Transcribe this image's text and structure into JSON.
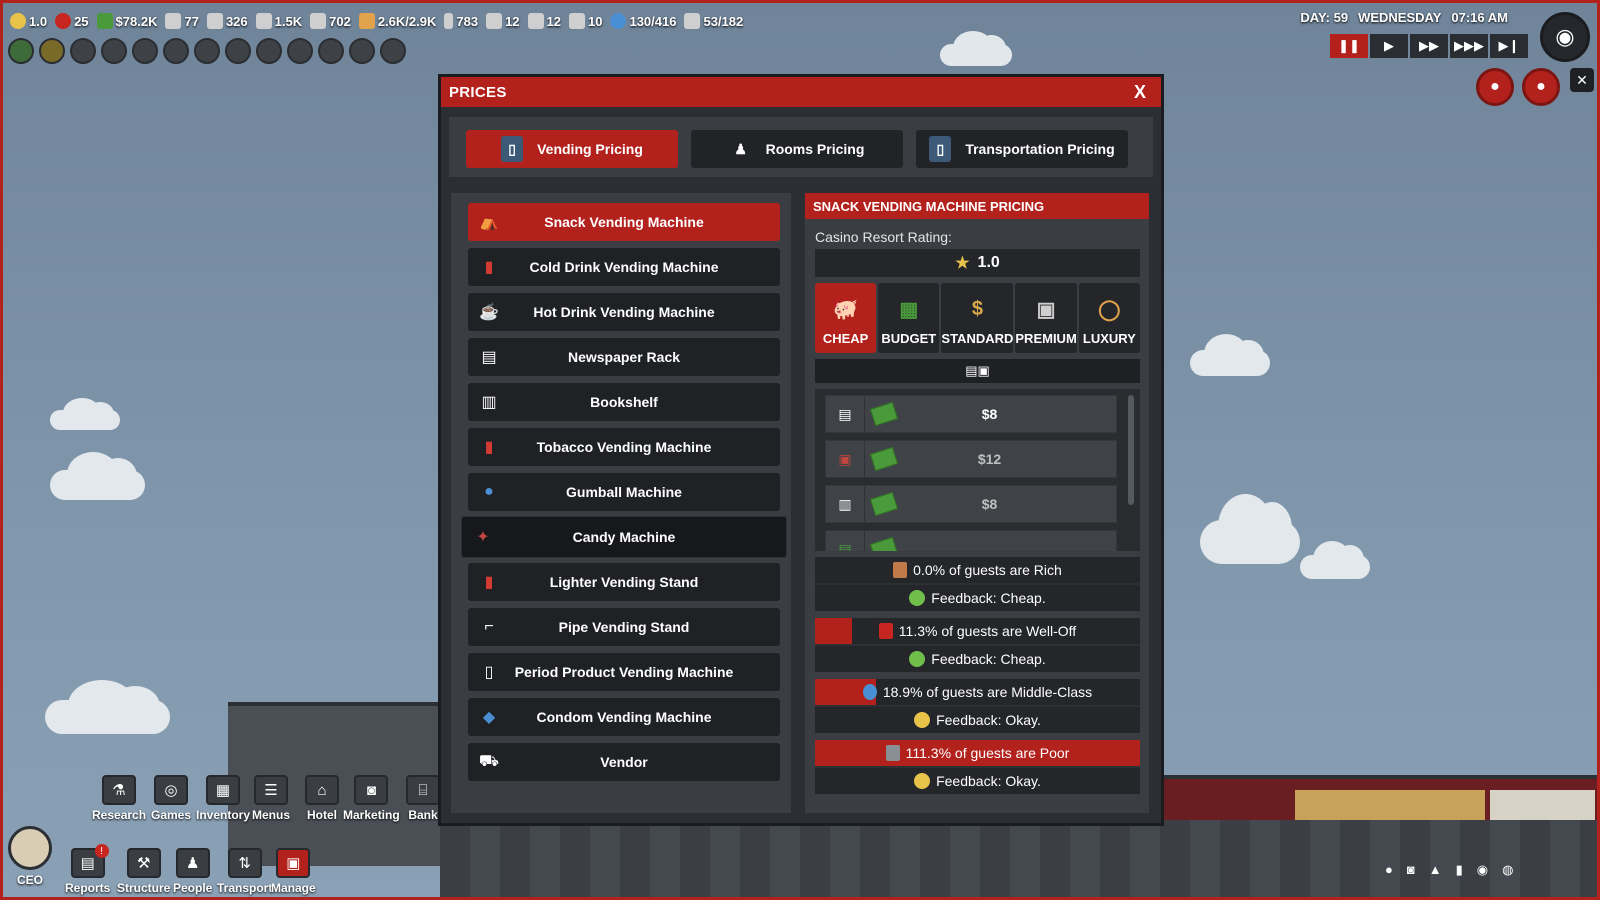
{
  "hud": {
    "stats": [
      {
        "icon": "star-icon",
        "value": "1.0",
        "color": "#e8c34a"
      },
      {
        "icon": "angry-face-icon",
        "value": "25",
        "color": "#c62520"
      },
      {
        "icon": "cash-icon",
        "value": "$78.2K",
        "color": "#4a9a3c"
      },
      {
        "icon": "document-icon",
        "value": "77",
        "color": "#cfcfcf"
      },
      {
        "icon": "staff-icon",
        "value": "326",
        "color": "#cfcfcf"
      },
      {
        "icon": "building-icon",
        "value": "1.5K",
        "color": "#cfcfcf"
      },
      {
        "icon": "clipboard-icon",
        "value": "702",
        "color": "#cfcfcf"
      },
      {
        "icon": "capacity-icon",
        "value": "2.6K/2.9K",
        "color": "#e0a24a"
      },
      {
        "icon": "battery-icon",
        "value": "783",
        "color": "#cfcfcf"
      },
      {
        "icon": "worker-icon",
        "value": "12",
        "color": "#cfcfcf"
      },
      {
        "icon": "machine-icon",
        "value": "12",
        "color": "#cfcfcf"
      },
      {
        "icon": "train-icon",
        "value": "10",
        "color": "#cfcfcf"
      },
      {
        "icon": "guest-icon",
        "value": "130/416",
        "color": "#4a8fd4"
      },
      {
        "icon": "people-icon",
        "value": "53/182",
        "color": "#cfcfcf"
      }
    ],
    "day": "DAY: 59",
    "weekday": "WEDNESDAY",
    "time": "07:16 AM"
  },
  "modal": {
    "title": "PRICES",
    "close": "X",
    "tabs": [
      {
        "label": "Vending Pricing",
        "icon": "vending-machine-icon"
      },
      {
        "label": "Rooms Pricing",
        "icon": "bellhop-icon"
      },
      {
        "label": "Transportation Pricing",
        "icon": "elevator-icon"
      }
    ],
    "machines": [
      "Snack Vending Machine",
      "Cold Drink Vending Machine",
      "Hot Drink Vending Machine",
      "Newspaper Rack",
      "Bookshelf",
      "Tobacco Vending Machine",
      "Gumball Machine",
      "Candy Machine",
      "Lighter Vending Stand",
      "Pipe Vending Stand",
      "Period Product Vending Machine",
      "Condom Vending Machine",
      "Vendor"
    ],
    "detail": {
      "title": "SNACK VENDING MACHINE PRICING",
      "rating_label": "Casino Resort Rating:",
      "rating_value": "1.0",
      "tiers": [
        "CHEAP",
        "BUDGET",
        "STANDARD",
        "PREMIUM",
        "LUXURY"
      ],
      "items": [
        "$8",
        "$12",
        "$8"
      ],
      "guests": [
        {
          "label": "0.0% of guests are Rich",
          "feedback": "Feedback: Cheap.",
          "share": 0.0,
          "mood": "happy"
        },
        {
          "label": "11.3% of guests are Well-Off",
          "feedback": "Feedback: Cheap.",
          "share": 0.113,
          "mood": "happy"
        },
        {
          "label": "18.9% of guests are Middle-Class",
          "feedback": "Feedback: Okay.",
          "share": 0.189,
          "mood": "neutral"
        },
        {
          "label": "111.3% of guests are Poor",
          "feedback": "Feedback: Okay.",
          "share": 1.0,
          "mood": "neutral"
        }
      ]
    }
  },
  "toolbar": {
    "top_row": [
      "Research",
      "Games",
      "Inventory",
      "Menus",
      "Hotel",
      "Marketing",
      "Bank"
    ],
    "bottom_row": [
      "CEO",
      "Reports",
      "Structure",
      "People",
      "Transport",
      "Manage"
    ],
    "reports_badge": "!"
  },
  "colors": {
    "accent": "#b3211d",
    "panel": "#3a3d42",
    "button": "#1f2125",
    "happy": "#6fbf4a",
    "neutral": "#e8c34a"
  }
}
